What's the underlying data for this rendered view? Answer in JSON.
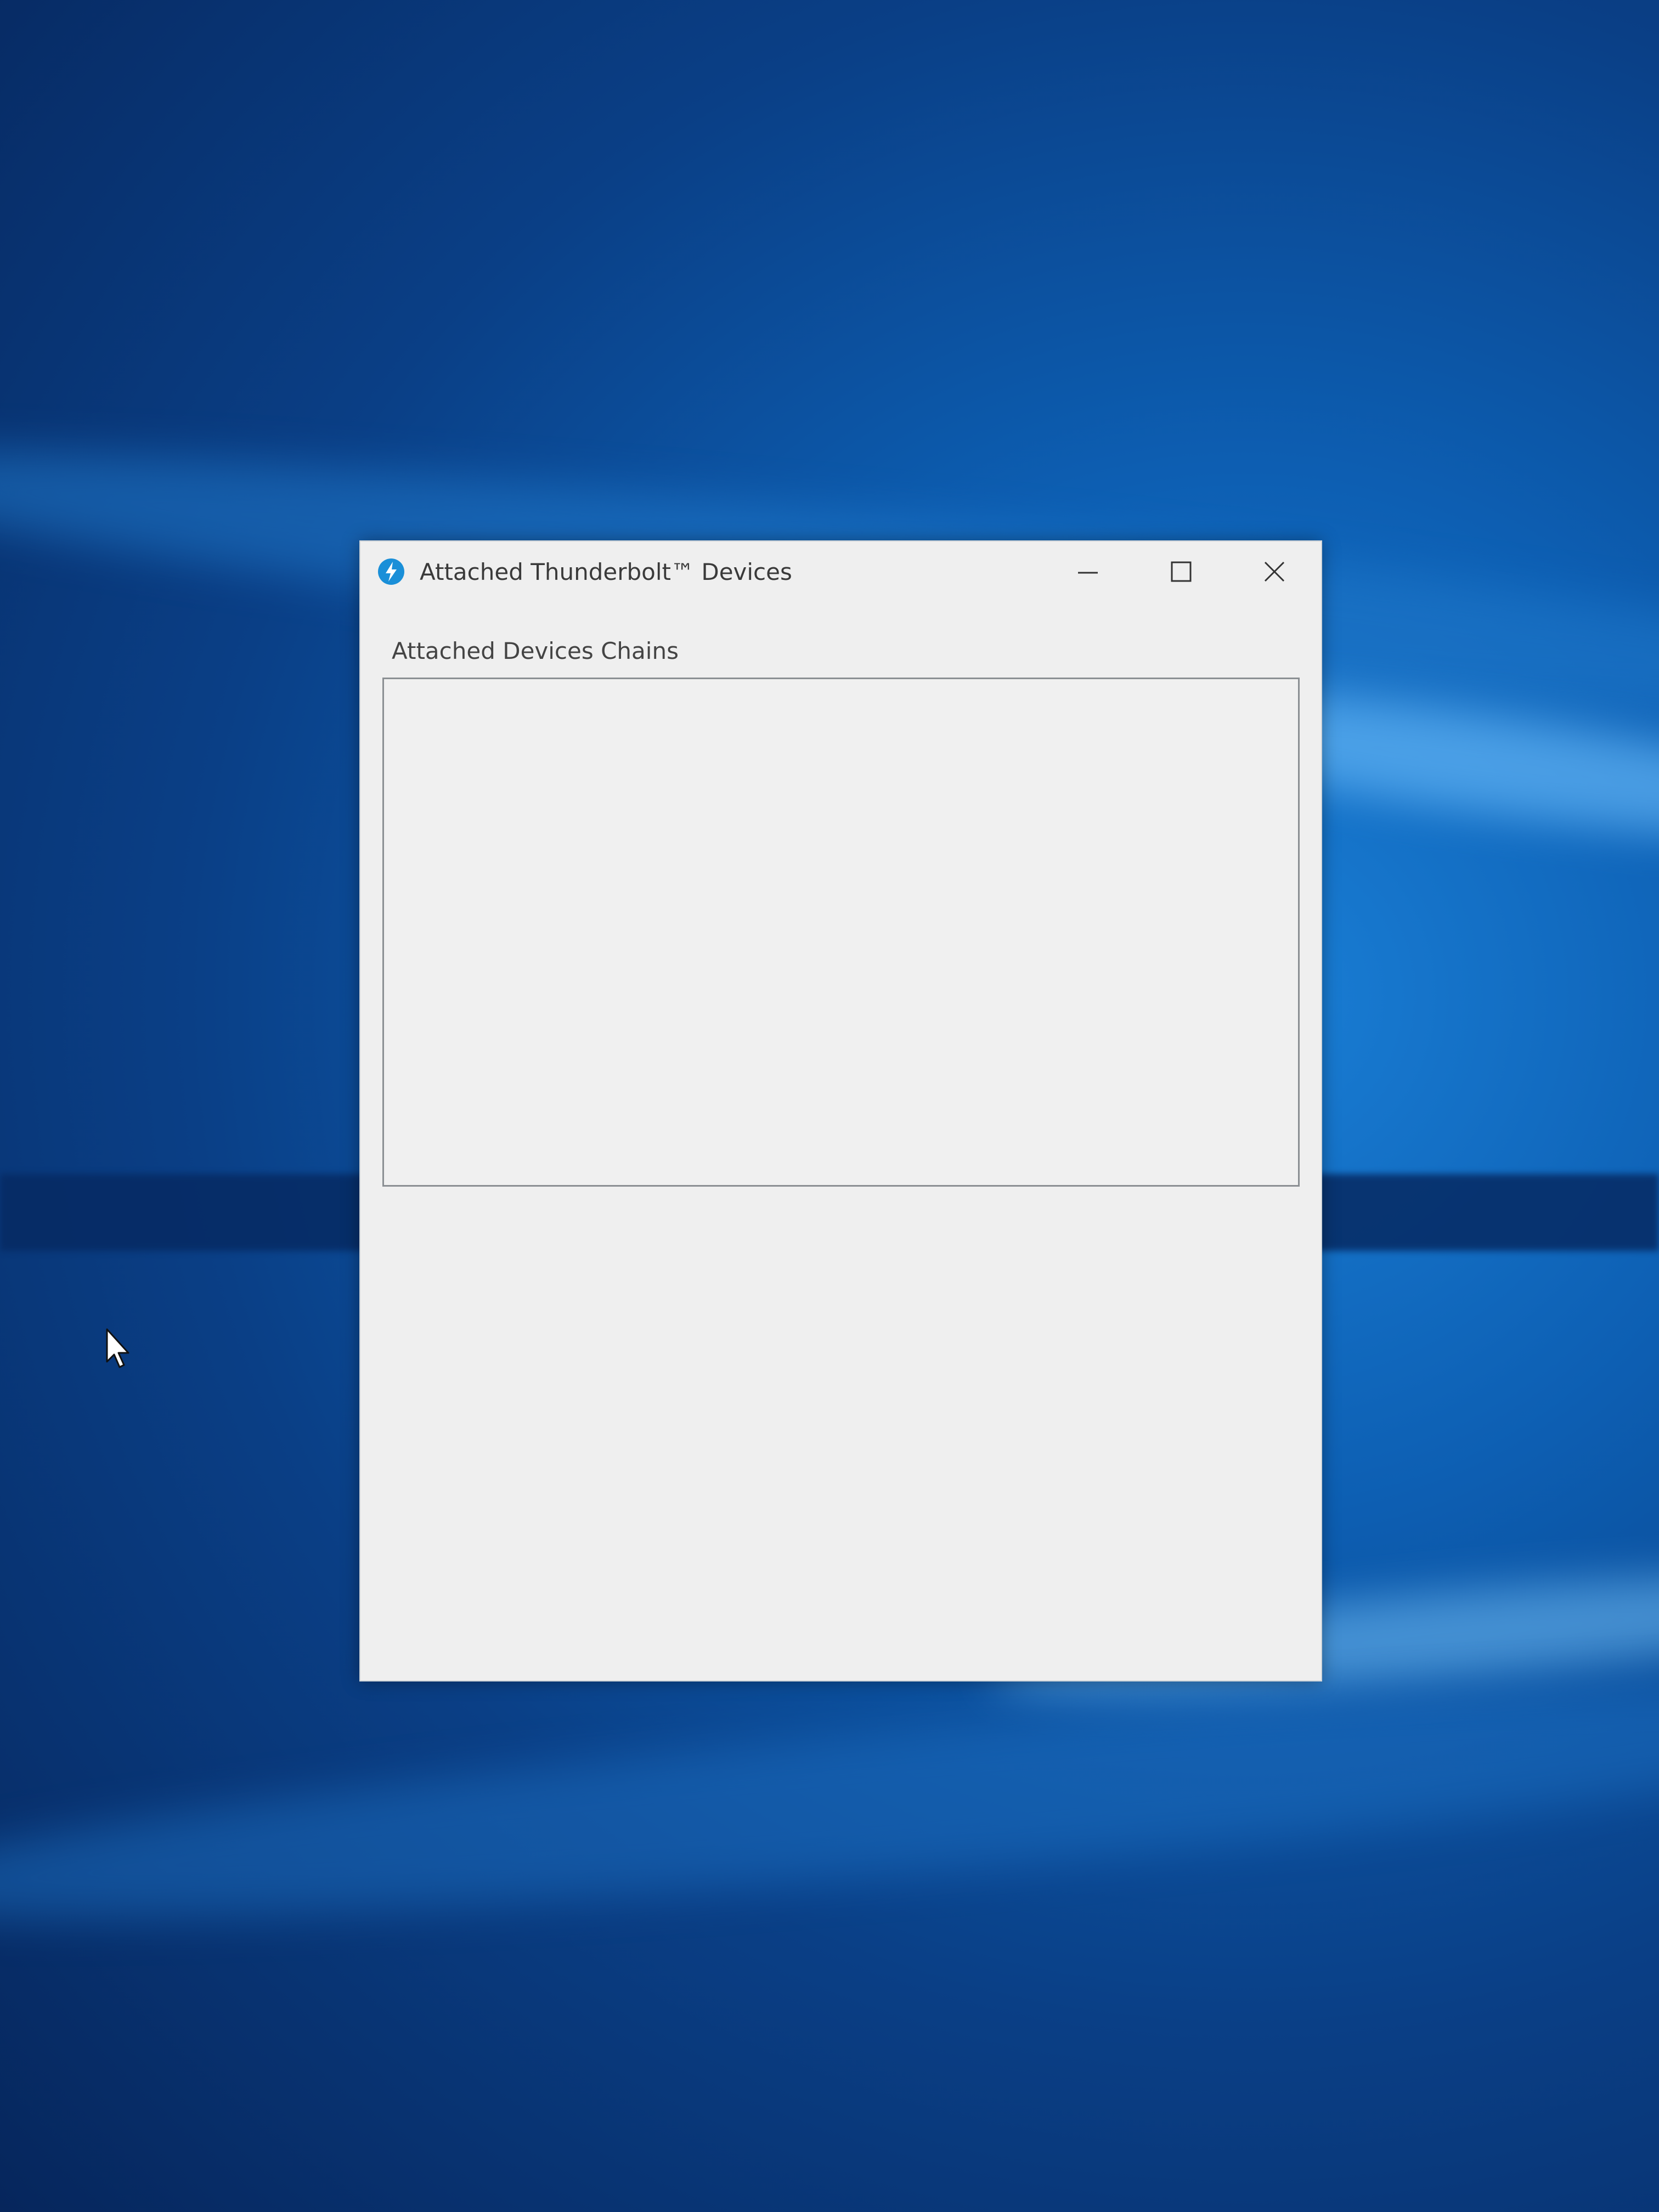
{
  "window": {
    "title": "Attached Thunderbolt™ Devices",
    "app_icon": "thunderbolt-icon",
    "controls": {
      "minimize_icon": "minimize-icon",
      "maximize_icon": "maximize-icon",
      "close_icon": "close-icon"
    }
  },
  "content": {
    "group_label": "Attached Devices Chains",
    "device_chains": []
  },
  "colors": {
    "window_bg": "#efefef",
    "accent": "#1a8fd8",
    "desktop": "#0d5fb3"
  }
}
